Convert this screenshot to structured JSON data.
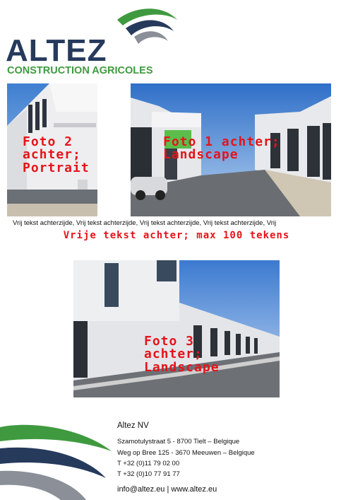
{
  "logo": {
    "wordmark": "ALTEZ",
    "subtitle": "CONSTRUCTION AGRICOLES",
    "colors": {
      "navy": "#263a5c",
      "green": "#3f9a3f",
      "grey": "#8a8f98"
    }
  },
  "photos": {
    "photo2": {
      "label": "Foto 2\nachter;\nPortrait"
    },
    "photo1": {
      "label": "Foto 1 achter;\nLandscape"
    },
    "photo3": {
      "label": "Foto 3\nachter;\nLandscape"
    }
  },
  "text": {
    "free_text": "Vrij tekst achterzijde, Vrij tekst achterzijde, Vrij tekst achterzijde, Vrij tekst achterzijde, Vrij",
    "free_title": "Vrije tekst achter; max 100 tekens",
    "accent_color": "#e5141a"
  },
  "footer": {
    "company": "Altez NV",
    "address_1": "Szamotulystraat 5 - 8700 Tielt – Belgique",
    "address_2": "Weg op Bree 125 - 3670 Meeuwen – Belgique",
    "phone_1": "T +32 (0)11 79 02 00",
    "phone_2": "T +32 (0)10 77 91 77",
    "web": "info@altez.eu | www.altez.eu"
  }
}
